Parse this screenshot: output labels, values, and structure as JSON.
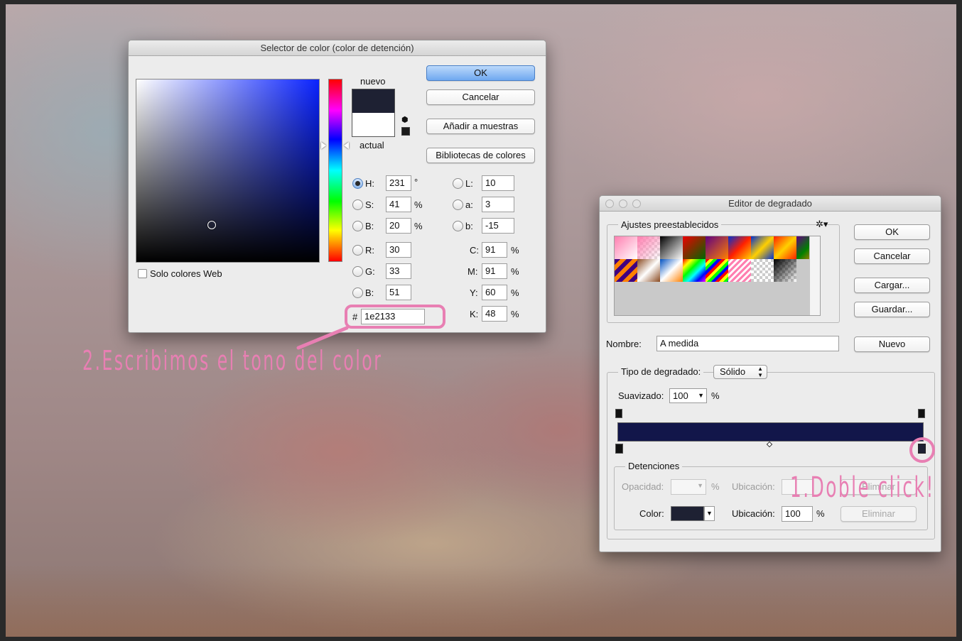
{
  "colors": {
    "selected_color": "#1e2133",
    "annotation_pink": "#e87fb3",
    "button_default_blue": "#6fa8f0"
  },
  "annotations": {
    "step2": "2.Escribimos el tono del color",
    "step1": "1.Doble click!"
  },
  "color_picker": {
    "title": "Selector de color (color de detención)",
    "new_label": "nuevo",
    "current_label": "actual",
    "ok_label": "OK",
    "cancel_label": "Cancelar",
    "add_swatches_label": "Añadir a muestras",
    "libraries_label": "Bibliotecas de colores",
    "web_only_label": "Solo colores Web",
    "hex_prefix": "#",
    "hex_value": "1e2133",
    "hsb": {
      "h_label": "H:",
      "h": "231",
      "h_unit": "°",
      "s_label": "S:",
      "s": "41",
      "s_unit": "%",
      "b_label": "B:",
      "b": "20",
      "b_unit": "%"
    },
    "rgb": {
      "r_label": "R:",
      "r": "30",
      "g_label": "G:",
      "g": "33",
      "b_label": "B:",
      "b": "51"
    },
    "lab": {
      "l_label": "L:",
      "l": "10",
      "a_label": "a:",
      "a": "3",
      "b_label": "b:",
      "b": "-15"
    },
    "cmyk": {
      "c_label": "C:",
      "c": "91",
      "m_label": "M:",
      "m": "91",
      "y_label": "Y:",
      "y": "60",
      "k_label": "K:",
      "k": "48",
      "unit": "%"
    }
  },
  "gradient_editor": {
    "title": "Editor de degradado",
    "presets_label": "Ajustes preestablecidos",
    "ok_label": "OK",
    "cancel_label": "Cancelar",
    "load_label": "Cargar...",
    "save_label": "Guardar...",
    "name_label": "Nombre:",
    "name_value": "A medida",
    "new_label": "Nuevo",
    "gradient_type_label": "Tipo de degradado:",
    "gradient_type_value": "Sólido",
    "smoothness_label": "Suavizado:",
    "smoothness_value": "100",
    "smoothness_unit": "%",
    "stops_label": "Detenciones",
    "opacity_label": "Opacidad:",
    "opacity_unit": "%",
    "location_label_1": "Ubicación:",
    "delete_label_1": "Eliminar",
    "color_label": "Color:",
    "location_label_2": "Ubicación:",
    "location_value": "100",
    "location_unit": "%",
    "delete_label_2": "Eliminar"
  }
}
